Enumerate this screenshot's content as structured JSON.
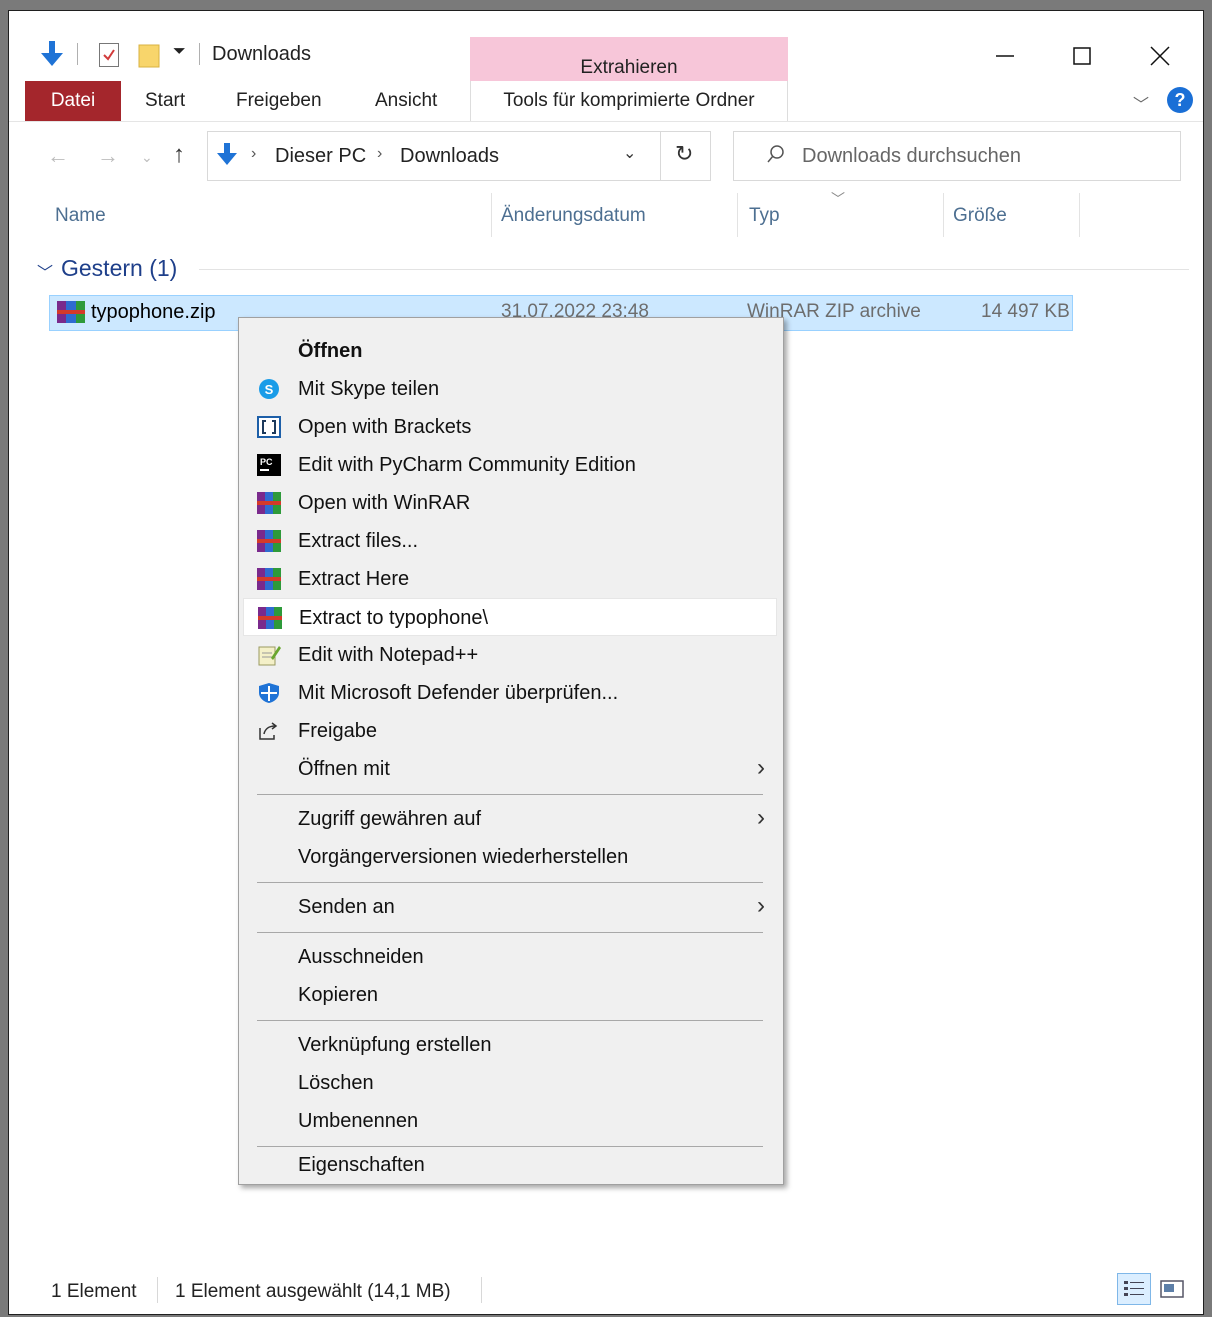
{
  "window": {
    "title": "Downloads"
  },
  "contextual_tab": {
    "header": "Extrahieren",
    "label": "Tools für komprimierte Ordner"
  },
  "ribbon": {
    "tabs": [
      "Datei",
      "Start",
      "Freigeben",
      "Ansicht"
    ]
  },
  "address_bar": {
    "crumbs": [
      "Dieser PC",
      "Downloads"
    ]
  },
  "search": {
    "placeholder": "Downloads durchsuchen"
  },
  "columns": [
    "Name",
    "Änderungsdatum",
    "Typ",
    "Größe"
  ],
  "group": {
    "title": "Gestern (1)"
  },
  "file": {
    "name": "typophone.zip",
    "date": "31.07.2022 23:48",
    "type": "WinRAR ZIP archive",
    "size": "14 497 KB"
  },
  "context_menu": {
    "items": [
      "Öffnen",
      "Mit Skype teilen",
      "Open with Brackets",
      "Edit with PyCharm Community Edition",
      "Open with WinRAR",
      "Extract files...",
      "Extract Here",
      "Extract to typophone\\",
      "Edit with Notepad++",
      "Mit Microsoft Defender überprüfen...",
      "Freigabe",
      "Öffnen mit",
      "Zugriff gewähren auf",
      "Vorgängerversionen wiederherstellen",
      "Senden an",
      "Ausschneiden",
      "Kopieren",
      "Verknüpfung erstellen",
      "Löschen",
      "Umbenennen",
      "Eigenschaften"
    ],
    "hovered": "Extract to typophone\\"
  },
  "status_bar": {
    "count": "1 Element",
    "selection": "1 Element ausgewählt (14,1 MB)"
  },
  "colors": {
    "file_tab": "#a4262c",
    "context_tab": "#f7c6d9",
    "selection": "#cce8ff",
    "accent": "#1a6fd6"
  }
}
